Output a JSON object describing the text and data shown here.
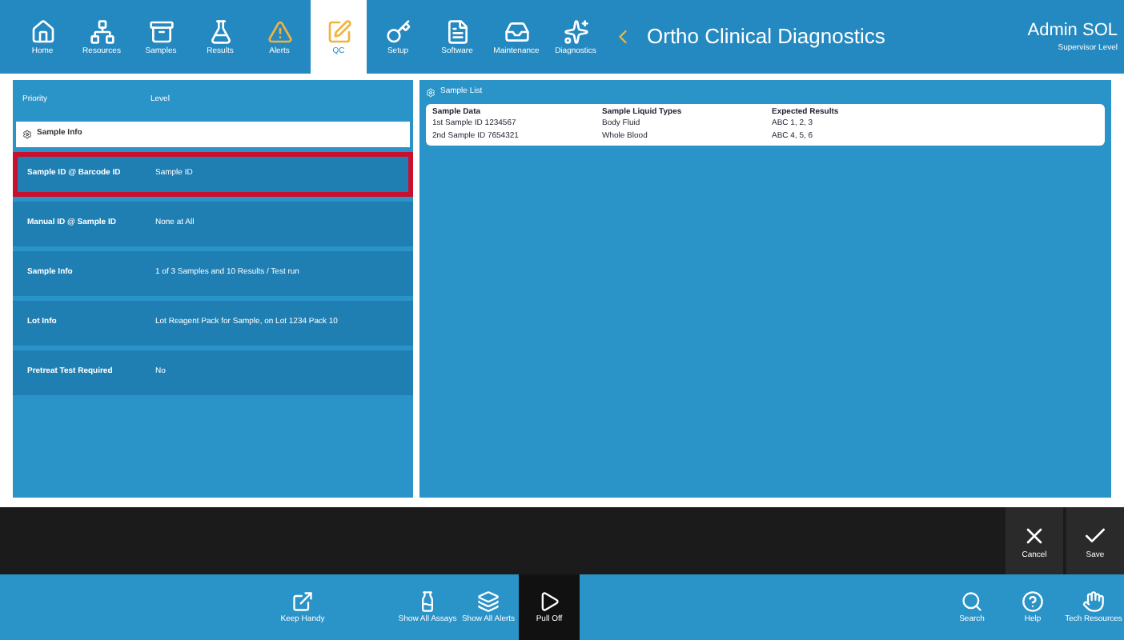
{
  "nav": [
    {
      "label": "Home",
      "selected": false
    },
    {
      "label": "Resources",
      "selected": false
    },
    {
      "label": "Samples",
      "selected": false
    },
    {
      "label": "Results",
      "selected": false
    },
    {
      "label": "Alerts",
      "selected": false
    },
    {
      "label": "QC",
      "selected": true
    },
    {
      "label": "Setup",
      "selected": false
    },
    {
      "label": "Software",
      "selected": false
    },
    {
      "label": "Maintenance",
      "selected": false
    },
    {
      "label": "Diagnostics",
      "selected": false
    }
  ],
  "brand": "Ortho Clinical Diagnostics",
  "user": {
    "name": "Admin SOL",
    "role": "Supervisor Level"
  },
  "left_panel": {
    "top_row": {
      "label": "Priority",
      "value": "Level"
    },
    "section": "Sample Info",
    "rows": [
      {
        "label": "Sample ID @ Barcode ID",
        "value": "Sample ID",
        "selected": true
      },
      {
        "label": "Manual ID @ Sample ID",
        "value": "None at All",
        "selected": false
      },
      {
        "label": "Sample Info",
        "value": "1 of 3 Samples and 10 Results / Test run",
        "selected": false
      },
      {
        "label": "Lot Info",
        "value": "Lot Reagent Pack for Sample, on Lot 1234 Pack 10",
        "selected": false
      },
      {
        "label": "Pretreat Test Required",
        "value": "No",
        "selected": false
      }
    ]
  },
  "right_panel": {
    "title": "Sample List",
    "columns": [
      "Sample Data",
      "Sample Liquid Types",
      "Expected Results"
    ],
    "rows": [
      [
        "1st Sample ID 1234567",
        "Body Fluid",
        "ABC 1, 2, 3"
      ],
      [
        "2nd Sample ID 7654321",
        "Whole Blood",
        "ABC 4, 5, 6"
      ]
    ]
  },
  "action_buttons": [
    "Cancel",
    "Save"
  ],
  "toolbar_center": [
    {
      "label": "Keep Handy",
      "active": false
    },
    {
      "label": "Show All Assays",
      "active": false
    },
    {
      "label": "Show All Alerts",
      "active": false
    },
    {
      "label": "Pull Off",
      "active": true
    }
  ],
  "toolbar_right": [
    "Search",
    "Help",
    "Tech Resources"
  ]
}
